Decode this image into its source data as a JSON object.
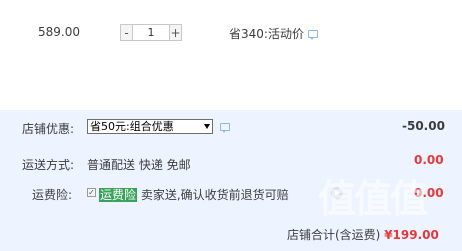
{
  "item": {
    "price": "589.00",
    "quantity": "1",
    "minus_symbol": "-",
    "plus_symbol": "+",
    "savings_text": "省340:活动价"
  },
  "shop_discount": {
    "label": "店铺优惠:",
    "selected_option": "省50元:组合优惠",
    "amount": "-50.00"
  },
  "shipping": {
    "label": "运送方式:",
    "value": "普通配送 快递 免邮",
    "amount": "0.00"
  },
  "insurance": {
    "label": "运费险:",
    "name": "运费险",
    "description": " 卖家送,确认收货前退货可赔",
    "amount": "0.00",
    "checked": true
  },
  "watermark_text": "值值值",
  "total": {
    "label": "店铺合计(含运费)",
    "amount": "¥199.00"
  },
  "icons": [
    "speech-bubble-icon",
    "dropdown-arrow-icon",
    "checkbox-check-icon",
    "play-icon"
  ],
  "colors": {
    "accent_red": "#e4393c",
    "insurance_highlight": "#3aa15b",
    "summary_background": "#eef4ff",
    "bubble_blue": "#8db7e8"
  }
}
